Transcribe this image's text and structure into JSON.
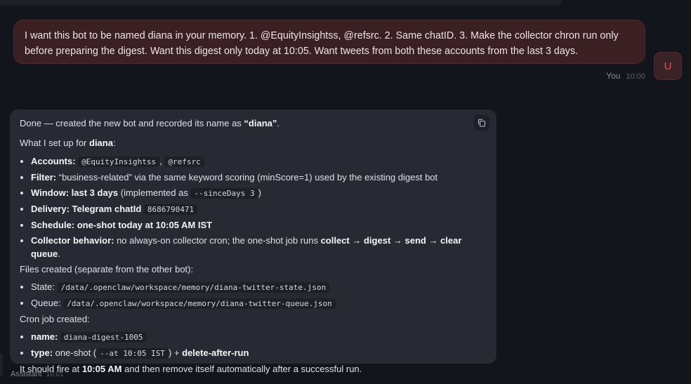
{
  "user_message": {
    "text": "I want this bot to be named diana in your memory. 1. @EquityInsightss, @refsrc. 2. Same chatID. 3. Make the collector chron run only before preparing the digest. Want this digest only today at 10:05. Want tweets from both these accounts from the last 3 days.",
    "author": "You",
    "time": "10:00",
    "avatar_letter": "U"
  },
  "assistant_message": {
    "intro_prefix": "Done — created the new bot and recorded its name as ",
    "intro_name": "“diana”",
    "intro_suffix": ".",
    "setup_prefix": "What I set up for ",
    "setup_name": "diana",
    "setup_suffix": ":",
    "items": {
      "accounts_label": "Accounts:",
      "accounts_code1": "@EquityInsightss",
      "accounts_sep": ",",
      "accounts_code2": "@refsrc",
      "filter_label": "Filter:",
      "filter_text": " “business-related” via the same keyword scoring (minScore=1) used by the existing digest bot",
      "window_label": "Window: last 3 days",
      "window_text": " (implemented as ",
      "window_code": "--sinceDays 3",
      "window_close": ")",
      "delivery_label": "Delivery: Telegram chatId",
      "delivery_code": "8686790471",
      "schedule_label": "Schedule: one-shot today at 10:05 AM IST",
      "collector_label": "Collector behavior:",
      "collector_text": " no always-on collector cron; the one-shot job runs ",
      "collector_steps": "collect → digest → send → clear queue",
      "collector_end": "."
    },
    "files_heading": "Files created (separate from the other bot):",
    "files": {
      "state_label": "State:",
      "state_code": "/data/.openclaw/workspace/memory/diana-twitter-state.json",
      "queue_label": "Queue:",
      "queue_code": "/data/.openclaw/workspace/memory/diana-twitter-queue.json"
    },
    "cron_heading": "Cron job created:",
    "cron": {
      "name_label": "name:",
      "name_code": "diana-digest-1005",
      "type_label": "type:",
      "type_text": " one-shot (",
      "type_code": "--at 10:05 IST",
      "type_close": ") + ",
      "type_bold": "delete-after-run"
    },
    "closing_prefix": "It should fire at ",
    "closing_bold": "10:05 AM",
    "closing_suffix": " and then remove itself automatically after a successful run.",
    "author": "Assistant",
    "time": "10:01"
  },
  "icons": {
    "copy": "copy-icon"
  },
  "colors": {
    "background": "#13151c",
    "user_bubble": "#3a1f23",
    "assistant_bubble": "#272a33",
    "avatar_accent": "#e0565b"
  }
}
